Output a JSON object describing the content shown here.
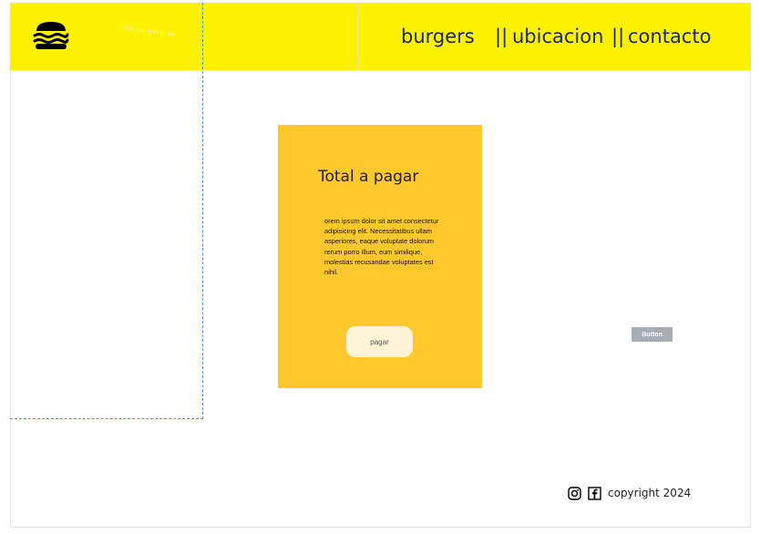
{
  "header": {
    "logo_icon": "burger-icon",
    "faint_text": "que se metal ae",
    "nav": {
      "burgers": "burgers",
      "separator": "||",
      "ubicacion": "ubicacion",
      "contacto": "contacto"
    },
    "accent_color": "#fff200"
  },
  "card": {
    "title": "Total a pagar",
    "body": "orem ipsum dolor sit amet consectetur adipisicing elit. Necessitatibus ullam asperiores, eaque voluptate dolorum rerum porro illum, eum similique, molestias recusandae voluptates est nihil.",
    "pay_button": "pagar",
    "background_color": "#ffc82c"
  },
  "aside": {
    "button_label": "Button"
  },
  "footer": {
    "icons": [
      "instagram-icon",
      "facebook-icon"
    ],
    "copyright": "copyright 2024"
  }
}
